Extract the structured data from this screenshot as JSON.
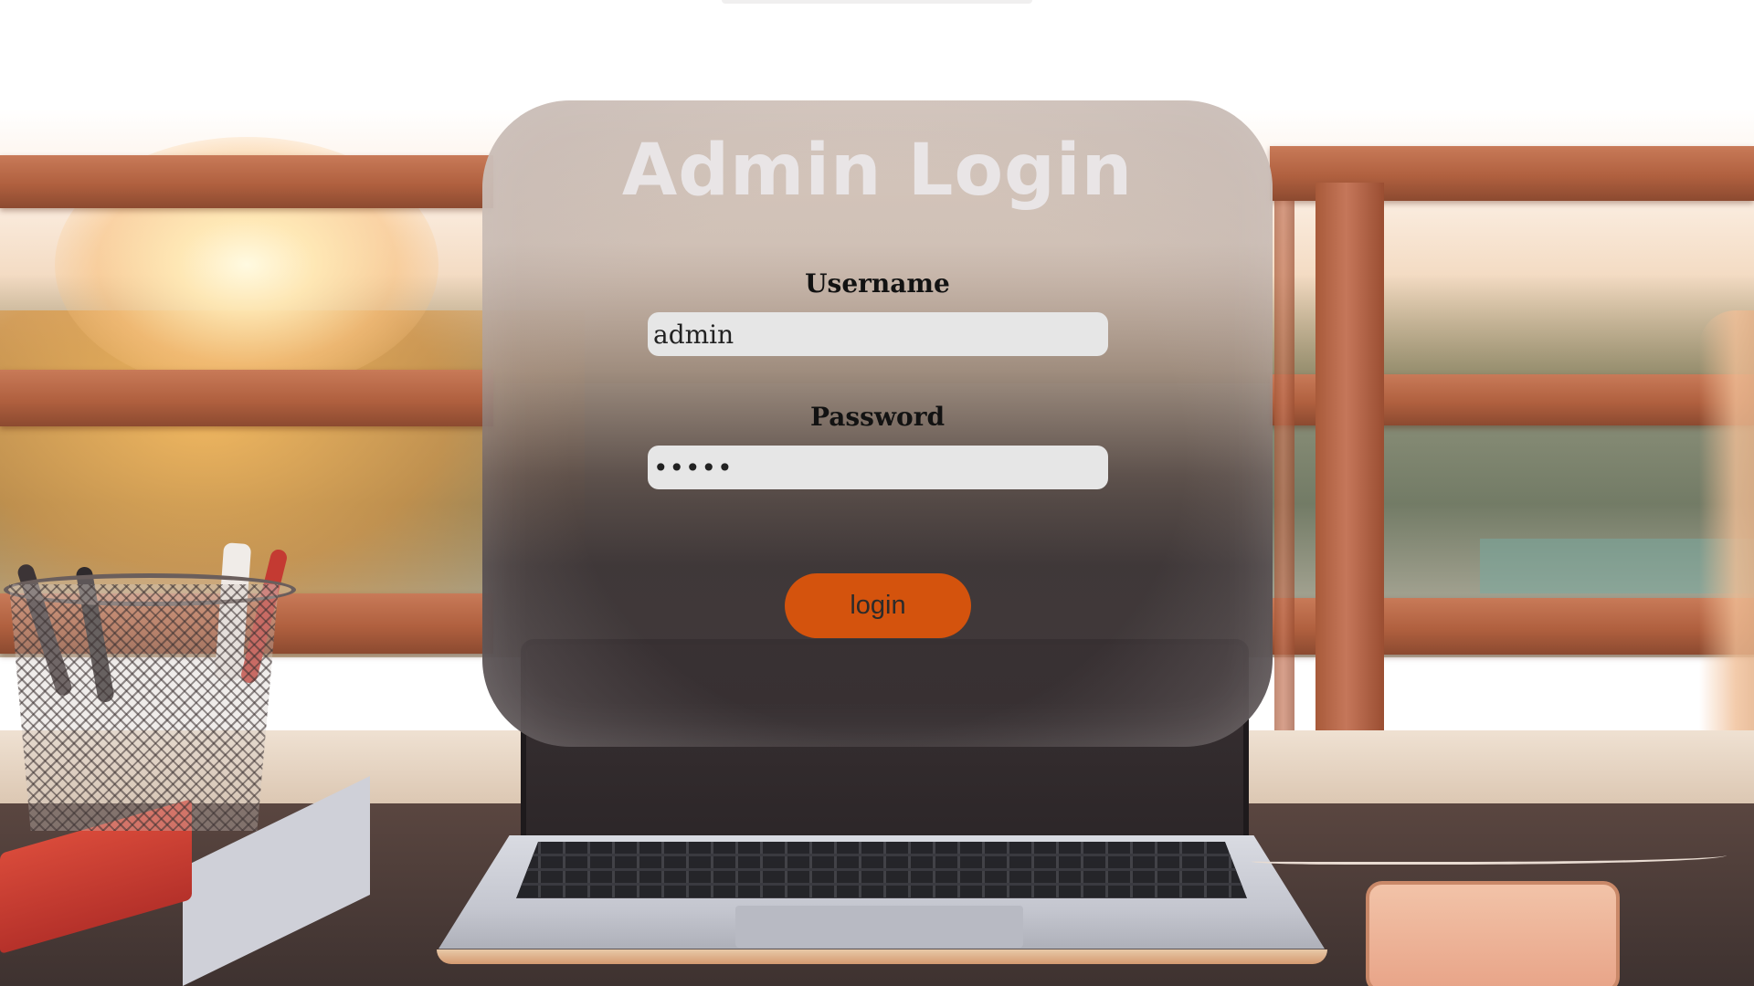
{
  "login": {
    "title": "Admin Login",
    "username_label": "Username",
    "username_value": "admin",
    "password_label": "Password",
    "password_value": "•••••",
    "button_label": "login"
  },
  "colors": {
    "button": "#d4530d",
    "input_background": "#e6e6e6",
    "title": "#e9e5e6"
  }
}
